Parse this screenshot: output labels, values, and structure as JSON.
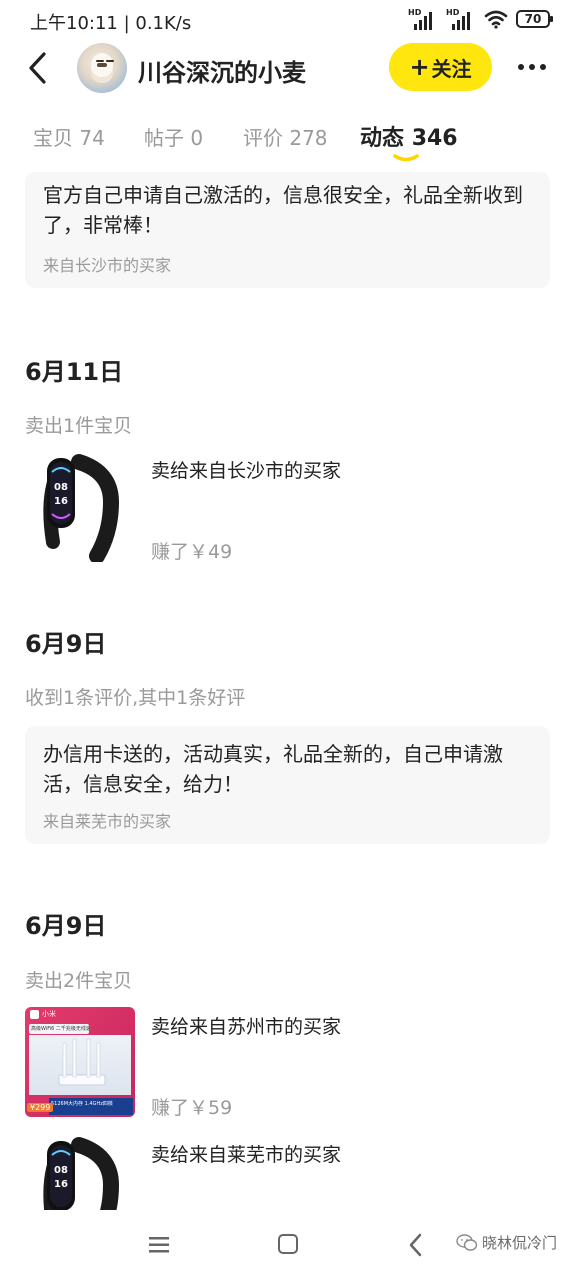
{
  "status_bar": {
    "time_speed": "上午10:11 | 0.1K/s",
    "battery": "70"
  },
  "header": {
    "user_name": "川谷深沉的小麦",
    "follow_label": "关注"
  },
  "tabs": [
    {
      "label": "宝贝",
      "count": "74",
      "active": false
    },
    {
      "label": "帖子",
      "count": "0",
      "active": false
    },
    {
      "label": "评价",
      "count": "278",
      "active": false
    },
    {
      "label": "动态",
      "count": "346",
      "active": true
    }
  ],
  "feed": {
    "top_review": {
      "text": "官方自己申请自己激活的，信息很安全，礼品全新收到了，非常棒！",
      "source": "来自长沙市的买家"
    },
    "section1": {
      "date": "6月11日",
      "subtitle": "卖出1件宝贝",
      "item": {
        "title": "卖给来自长沙市的买家",
        "earned": "赚了￥49",
        "thumb_text": "08\n16"
      }
    },
    "section2": {
      "date": "6月9日",
      "subtitle": "收到1条评价,其中1条好评",
      "review": {
        "text": "办信用卡送的，活动真实，礼品全新的，自己申请激活，信息安全，给力！",
        "source": "来自莱芜市的买家"
      }
    },
    "section3": {
      "date": "6月9日",
      "subtitle": "卖出2件宝贝",
      "items": [
        {
          "title": "卖给来自苏州市的买家",
          "earned": "赚了￥59",
          "thumb": {
            "brand": "小米",
            "banner": "高级WiFi6 二千兆级无线速率",
            "price": "¥299",
            "strip": "5126M大内存 1.4GHz四核"
          }
        },
        {
          "title": "卖给来自莱芜市的买家",
          "thumb_text": "08\n16"
        }
      ]
    }
  },
  "watermark": "晓林侃冷门",
  "colors": {
    "accent": "#ffe60f",
    "text": "#222222",
    "muted": "#9a9a9a",
    "card_bg": "#f7f7f7"
  },
  "icons": [
    "back-arrow-icon",
    "avatar",
    "plus-icon",
    "more-dots-icon",
    "menu-icon",
    "home-icon",
    "back-icon",
    "wechat-icon"
  ]
}
